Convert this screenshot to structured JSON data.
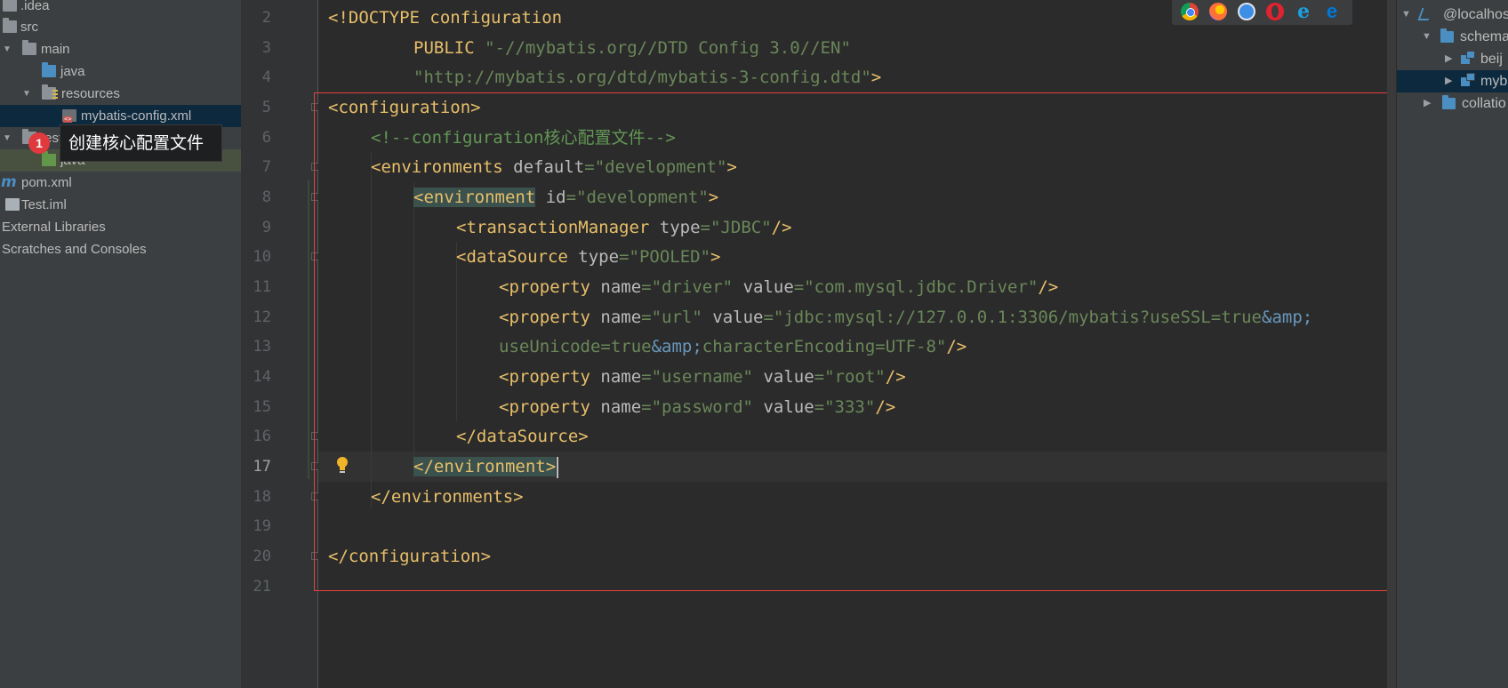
{
  "project_tree": [
    {
      "label": ".idea",
      "icon": "folder-icon",
      "arrow": "",
      "indent": 0
    },
    {
      "label": "src",
      "icon": "folder-icon",
      "arrow": "",
      "indent": 0
    },
    {
      "label": "main",
      "icon": "folder-icon",
      "arrow": "expanded",
      "indent": 1
    },
    {
      "label": "java",
      "icon": "source-folder-icon",
      "arrow": "",
      "indent": 2
    },
    {
      "label": "resources",
      "icon": "resources-folder-icon",
      "arrow": "expanded",
      "indent": 2
    },
    {
      "label": "mybatis-config.xml",
      "icon": "xml-file-icon",
      "arrow": "",
      "indent": 3,
      "selected": true
    },
    {
      "label": "test",
      "icon": "folder-icon",
      "arrow": "expanded",
      "indent": 1
    },
    {
      "label": "java",
      "icon": "test-folder-icon",
      "arrow": "",
      "indent": 2
    },
    {
      "label": "pom.xml",
      "icon": "maven-icon",
      "arrow": "",
      "indent": 0
    },
    {
      "label": "Test.iml",
      "icon": "iml-file-icon",
      "arrow": "",
      "indent": 0
    },
    {
      "label": "External Libraries",
      "icon": "",
      "arrow": "",
      "indent": 0
    },
    {
      "label": "Scratches and Consoles",
      "icon": "",
      "arrow": "",
      "indent": 0
    }
  ],
  "tooltip": {
    "badge": "1",
    "text": "创建核心配置文件"
  },
  "editor": {
    "line_numbers": [
      "2",
      "3",
      "4",
      "5",
      "6",
      "7",
      "8",
      "9",
      "10",
      "11",
      "12",
      "13",
      "14",
      "15",
      "16",
      "17",
      "18",
      "19",
      "20",
      "21"
    ],
    "current_line": "17"
  },
  "code": {
    "l2": {
      "t1": "<!DOCTYPE configuration"
    },
    "l3": {
      "t1": "PUBLIC ",
      "s1": "\"-//mybatis.org//DTD Config 3.0//EN\""
    },
    "l4": {
      "s1": "\"http://mybatis.org/dtd/mybatis-3-config.dtd\"",
      "t1": ">"
    },
    "l5": {
      "t1": "<configuration>"
    },
    "l6": {
      "c1": "<!--configuration核心配置文件-->"
    },
    "l7": {
      "t1": "<environments ",
      "a1": "default",
      "e": "=",
      "s1": "\"development\"",
      "t2": ">"
    },
    "l8": {
      "t1": "<environment",
      "sp": " ",
      "a1": "id",
      "e": "=",
      "s1": "\"development\"",
      "t2": ">"
    },
    "l9": {
      "t1": "<transactionManager ",
      "a1": "type",
      "e": "=",
      "s1": "\"JDBC\"",
      "t2": "/>"
    },
    "l10": {
      "t1": "<dataSource ",
      "a1": "type",
      "e": "=",
      "s1": "\"POOLED\"",
      "t2": ">"
    },
    "l11": {
      "t1": "<property ",
      "a1": "name",
      "e1": "=",
      "s1": "\"driver\"",
      "sp": " ",
      "a2": "value",
      "e2": "=",
      "s2": "\"com.mysql.jdbc.Driver\"",
      "t2": "/>"
    },
    "l12": {
      "t1": "<property ",
      "a1": "name",
      "e1": "=",
      "s1": "\"url\"",
      "sp": " ",
      "a2": "value",
      "e2": "=",
      "s2": "\"jdbc:mysql://127.0.0.1:3306/mybatis?useSSL=true",
      "ent": "&amp;"
    },
    "l13": {
      "s1": "useUnicode=true",
      "ent": "&amp;",
      "s2": "characterEncoding=UTF-8\"",
      "t2": "/>"
    },
    "l14": {
      "t1": "<property ",
      "a1": "name",
      "e1": "=",
      "s1": "\"username\"",
      "sp": " ",
      "a2": "value",
      "e2": "=",
      "s2": "\"root\"",
      "t2": "/>"
    },
    "l15": {
      "t1": "<property ",
      "a1": "name",
      "e1": "=",
      "s1": "\"password\"",
      "sp": " ",
      "a2": "value",
      "e2": "=",
      "s2": "\"333\"",
      "t2": "/>"
    },
    "l16": {
      "t1": "</dataSource>"
    },
    "l17": {
      "t1": "</environment>"
    },
    "l18": {
      "t1": "</environments>"
    },
    "l20": {
      "t1": "</configuration>"
    }
  },
  "browsers": [
    "chrome-icon",
    "firefox-icon",
    "safari-icon",
    "opera-icon",
    "ie-icon",
    "edge-icon"
  ],
  "database_tree": [
    {
      "label": "@localhos",
      "icon": "connection-icon",
      "arrow": "expanded",
      "indent": 0
    },
    {
      "label": "schema",
      "icon": "folder-icon",
      "arrow": "expanded",
      "indent": 1
    },
    {
      "label": "beij",
      "icon": "schema-icon",
      "arrow": "collapsed",
      "indent": 2
    },
    {
      "label": "myb",
      "icon": "schema-icon",
      "arrow": "collapsed",
      "indent": 2,
      "selected": true
    },
    {
      "label": "collatio",
      "icon": "folder-icon",
      "arrow": "collapsed",
      "indent": 1
    }
  ],
  "colors": {
    "tag": "#e8bf6a",
    "attribute": "#bababa",
    "string": "#6a8759",
    "entity": "#6897bb",
    "comment": "#629755",
    "selection_border": "#e8403f"
  }
}
